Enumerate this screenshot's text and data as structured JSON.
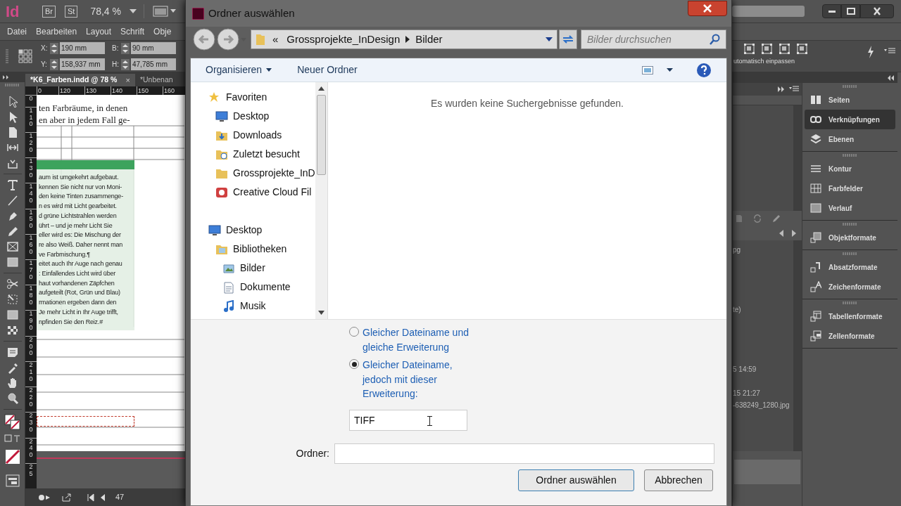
{
  "app_bar": {
    "logo": "Id",
    "bridge": "Br",
    "stock": "St",
    "zoom": "78,4 %"
  },
  "menu": [
    "Datei",
    "Bearbeiten",
    "Layout",
    "Schrift",
    "Obje"
  ],
  "transform_fields": [
    {
      "label": "X:",
      "value": "190 mm"
    },
    {
      "label": "Y:",
      "value": "158,937 mm"
    },
    {
      "label": "B:",
      "value": "90 mm"
    },
    {
      "label": "H:",
      "value": "47,785 mm"
    }
  ],
  "fitting_label": "utomatisch einpassen",
  "document_tabs": [
    {
      "label": "*K6_Farben.indd @ 78 %",
      "selected": true,
      "close": "×"
    },
    {
      "label": "*Unbenan",
      "selected": false
    }
  ],
  "ruler": {
    "horizontal": [
      "0",
      "120",
      "130",
      "140",
      "150",
      "160"
    ],
    "vertical": [
      "0",
      "110",
      "120",
      "130",
      "140",
      "150",
      "160",
      "170",
      "180",
      "190",
      "200",
      "210",
      "220",
      "230",
      "240",
      "25"
    ]
  },
  "page": {
    "body_lines": [
      "ten Farbräume, in denen",
      "en aber in jedem Fall ge-"
    ],
    "frame_lines": [
      "aum ist umgekehrt aufgebaut.",
      "kennen Sie nicht nur von Moni-",
      "den keine Tinten zusammenge-",
      "n es wird mit Licht gearbeitet.",
      "d grüne Lichtstrahlen werden",
      "ührt – und je mehr Licht Sie",
      "eller wird es: Die Mischung der",
      "re also Weiß. Daher nennt man",
      "ve Farbmischung.¶",
      "eitet auch Ihr Auge nach genau",
      ": Einfallendes Licht wird über",
      "haut vorhandenen Zäpfchen",
      "aufgeteilt (Rot, Grün und Blau)",
      "rmationen ergeben dann den",
      "Je mehr Licht in Ihr Auge trifft,",
      "npfinden Sie den Reiz.#"
    ]
  },
  "page_number": "47",
  "links_panel": {
    "lines": [
      "pg",
      "te)",
      "5 14:59",
      "15 21:27",
      "-638249_1280.jpg"
    ]
  },
  "dock": [
    [
      {
        "label": "Seiten",
        "selected": false
      },
      {
        "label": "Verknüpfungen",
        "selected": true
      },
      {
        "label": "Ebenen",
        "selected": false
      }
    ],
    [
      {
        "label": "Kontur",
        "selected": false
      },
      {
        "label": "Farbfelder",
        "selected": false
      },
      {
        "label": "Verlauf",
        "selected": false
      }
    ],
    [
      {
        "label": "Objektformate",
        "selected": false
      }
    ],
    [
      {
        "label": "Absatzformate",
        "selected": false
      },
      {
        "label": "Zeichenformate",
        "selected": false
      }
    ],
    [
      {
        "label": "Tabellenformate",
        "selected": false
      },
      {
        "label": "Zellenformate",
        "selected": false
      }
    ]
  ],
  "dialog": {
    "title": "Ordner auswählen",
    "path_prefix": "«",
    "path": [
      "Grossprojekte_InDesign",
      "Bilder"
    ],
    "search": {
      "placeholder": "Bilder durchsuchen"
    },
    "toolbar": {
      "organize": "Organisieren",
      "new_folder": "Neuer Ordner"
    },
    "navigation": [
      {
        "label": "Favoriten",
        "children": [
          {
            "label": "Desktop"
          },
          {
            "label": "Downloads"
          },
          {
            "label": "Zuletzt besucht"
          },
          {
            "label": "Grossprojekte_InD"
          },
          {
            "label": "Creative Cloud Fil"
          }
        ]
      },
      {
        "label": "Desktop",
        "children": [
          {
            "label": "Bibliotheken",
            "children": [
              {
                "label": "Bilder"
              },
              {
                "label": "Dokumente"
              },
              {
                "label": "Musik"
              }
            ]
          }
        ]
      }
    ],
    "empty_message": "Es wurden keine Suchergebnisse gefunden.",
    "options": [
      {
        "label": "Gleicher Dateiname und gleiche Erweiterung",
        "selected": false
      },
      {
        "label": "Gleicher Dateiname, jedoch mit dieser Erweiterung:",
        "selected": true
      }
    ],
    "extension": {
      "value": "TIFF"
    },
    "folder": {
      "label": "Ordner:"
    },
    "buttons": [
      "Ordner auswählen",
      "Abbrechen"
    ]
  }
}
